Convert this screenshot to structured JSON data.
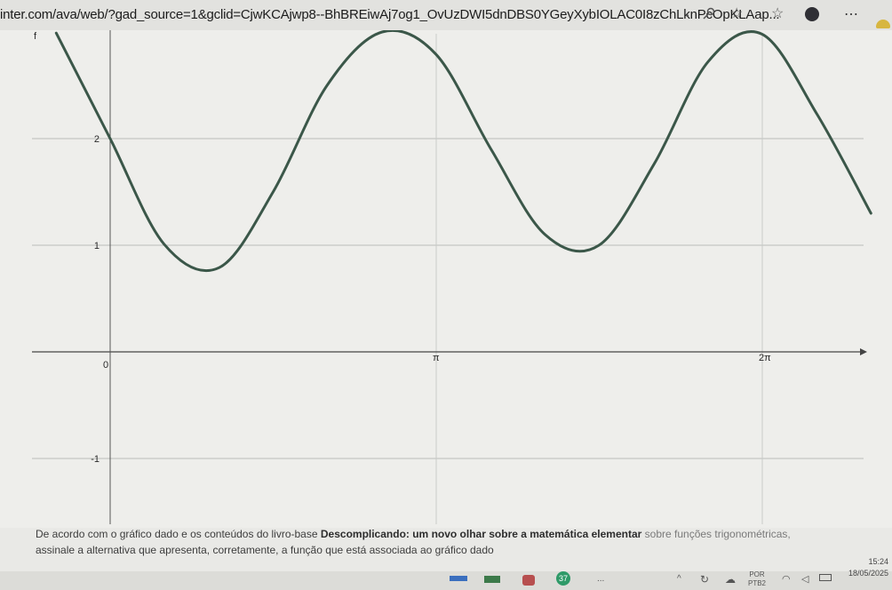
{
  "browser": {
    "url": "inter.com/ava/web/?gad_source=1&gclid=CjwKCAjwp8--BhBREiwAj7og1_OvUzDWI5dnDBS0YGeyXybIOLAC0I8zChLknPcOpKLAap..."
  },
  "chart_data": {
    "type": "line",
    "xlabel": "",
    "ylabel": "f",
    "x_tick_labels": [
      "0",
      "π",
      "2π"
    ],
    "y_tick_labels": [
      "2",
      "1",
      "-1"
    ],
    "series": [
      {
        "x": [
          -0.52,
          0.0,
          0.52,
          1.05,
          1.57,
          2.09,
          2.62,
          3.14,
          3.67,
          4.19,
          4.71,
          5.24,
          5.76,
          6.28,
          6.81,
          7.33
        ],
        "values": [
          2.99,
          2.0,
          1.01,
          0.79,
          1.5,
          2.5,
          3.0,
          2.79,
          1.9,
          1.1,
          1.0,
          1.76,
          2.72,
          2.98,
          2.23,
          1.3
        ]
      }
    ],
    "line_color": "#3b5749",
    "grid": true
  },
  "question": {
    "line1_pre": "De acordo com o gráfico dado e os conteúdos do livro-base",
    "line1_bold": "Descomplicando: um novo olhar sobre a matemática elementar",
    "line1_post": "sobre funções trigonométricas,",
    "line2": "assinale a alternativa que apresenta, corretamente, a função que está associada ao gráfico dado"
  },
  "taskbar": {
    "badge": "37",
    "overflow": "...",
    "lang_top": "POR",
    "lang_bottom": "PTB2",
    "time": "15:24",
    "date": "18/05/2025"
  }
}
